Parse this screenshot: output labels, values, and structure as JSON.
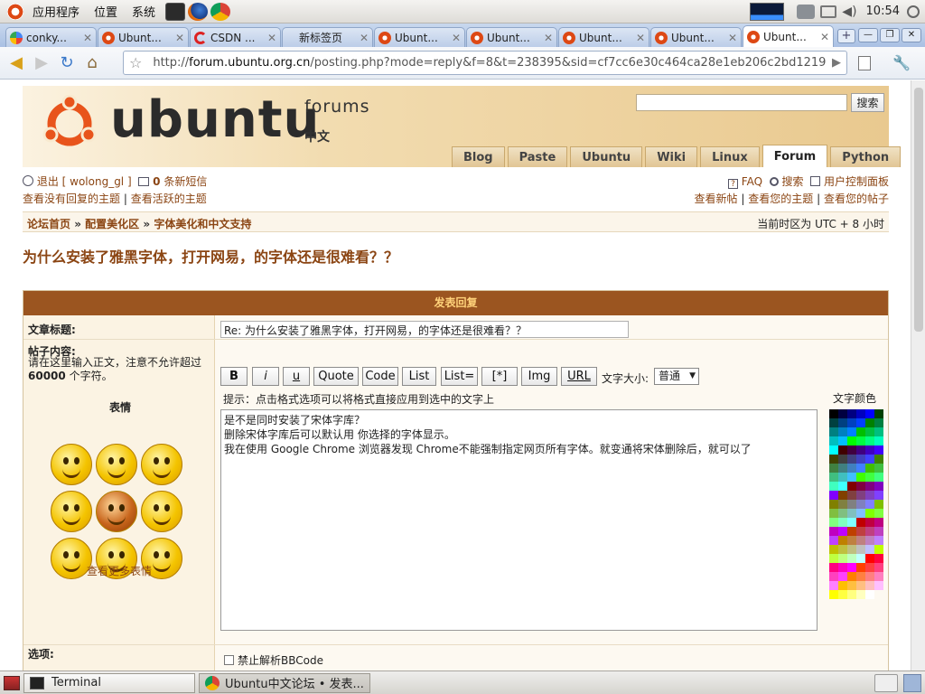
{
  "panel": {
    "menus": [
      "应用程序",
      "位置",
      "系统"
    ],
    "clock": "10:54"
  },
  "tabs": [
    {
      "title": "conky..."
    },
    {
      "title": "Ubunt..."
    },
    {
      "title": "CSDN ..."
    },
    {
      "title": "新标签页"
    },
    {
      "title": "Ubunt..."
    },
    {
      "title": "Ubunt..."
    },
    {
      "title": "Ubunt..."
    },
    {
      "title": "Ubunt..."
    },
    {
      "title": "Ubunt..."
    }
  ],
  "browser": {
    "url_prefix": "http://",
    "url_host": "forum.ubuntu.org.cn",
    "url_rest": "/posting.php?mode=reply&f=8&t=238395&sid=cf7cc6e30c464ca28e1eb206c2bd1219"
  },
  "header": {
    "brand": "ubuntu",
    "forums": "forums",
    "zh": "中文",
    "search_button": "搜索"
  },
  "nav": [
    "Blog",
    "Paste",
    "Ubuntu",
    "Wiki",
    "Linux",
    "Forum",
    "Python"
  ],
  "userlinks": {
    "logout": "退出 [ wolong_gl ]",
    "pm_count": "0",
    "pm_label": "条新短信",
    "faq": "FAQ",
    "search": "搜索",
    "ucp": "用户控制面板",
    "unanswered": "查看没有回复的主题",
    "active": "查看活跃的主题",
    "new_posts": "查看新帖",
    "your_topics": "查看您的主题",
    "your_posts": "查看您的帖子",
    "sep": "|"
  },
  "breadcrumb": {
    "home": "论坛首页",
    "sep": "»",
    "cat": "配置美化区",
    "forum": "字体美化和中文支持",
    "timezone": "当前时区为 UTC + 8 小时"
  },
  "page_title": "为什么安装了雅黑字体，打开网易，的字体还是很难看？？",
  "post": {
    "header": "发表回复",
    "subject_label": "文章标题:",
    "subject_value": "Re:  为什么安装了雅黑字体，打开网易，的字体还是很难看？？",
    "content_label": "帖子内容:",
    "content_hint_1": "请在这里输入正文，注意不允许超过",
    "content_hint_2": "60000",
    "content_hint_3": "个字符。",
    "emoticons_title": "表情",
    "more_emoticons": "查看更多表情",
    "buttons": [
      "B",
      "i",
      "u",
      "Quote",
      "Code",
      "List",
      "List=",
      "[*]",
      "Img",
      "URL"
    ],
    "fontsize_label": "文字大小:",
    "fontsize_value": "普通",
    "format_hint": "提示：点击格式选项可以将格式直接应用到选中的文字上",
    "color_label": "文字颜色",
    "body": "是不是同时安装了宋体字库？\n删除宋体字库后可以默认用 你选择的字体显示。\n我在使用 Google Chrome 浏览器发现 Chrome不能强制指定网页所有字体。就变通将宋体删除后，就可以了",
    "options_label": "选项:",
    "option_1": "禁止解析BBCode"
  },
  "taskbar": {
    "items": [
      "Terminal",
      "Ubuntu中文论坛 • 发表..."
    ]
  },
  "colors": {
    "accent": "#9b5520",
    "link": "#8b4513"
  }
}
